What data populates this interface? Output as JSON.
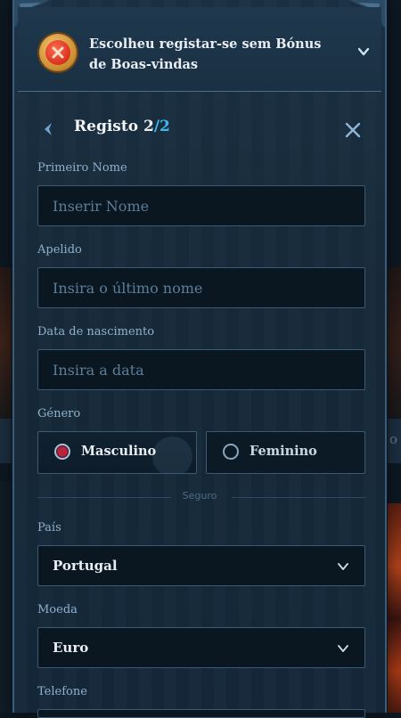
{
  "banner": {
    "text": "Escolheu registar-se sem Bónus de Boas-vindas"
  },
  "header": {
    "title": "Registo",
    "step": "2",
    "separator": "/",
    "total": "2"
  },
  "form": {
    "first_name": {
      "label": "Primeiro Nome",
      "placeholder": "Inserir Nome",
      "value": ""
    },
    "last_name": {
      "label": "Apelido",
      "placeholder": "Insira o último nome",
      "value": ""
    },
    "birth_date": {
      "label": "Data de nascimento",
      "placeholder": "Insira a data",
      "value": ""
    },
    "gender": {
      "label": "Género",
      "options": [
        "Masculino",
        "Feminino"
      ],
      "selected": "Masculino"
    },
    "divider_text": "Seguro",
    "country": {
      "label": "País",
      "value": "Portugal"
    },
    "currency": {
      "label": "Moeda",
      "value": "Euro"
    },
    "phone": {
      "label": "Telefone"
    }
  },
  "background": {
    "partial_text": "o"
  },
  "colors": {
    "accent": "#3eb9ee",
    "label": "#8fb2cc",
    "radio_selected": "#b8233f"
  },
  "icons": {
    "banner": "no-bonus-x-icon",
    "back": "chevron-left-icon",
    "close": "close-icon",
    "banner_toggle": "chevron-down-icon",
    "select": "chevron-down-icon"
  }
}
